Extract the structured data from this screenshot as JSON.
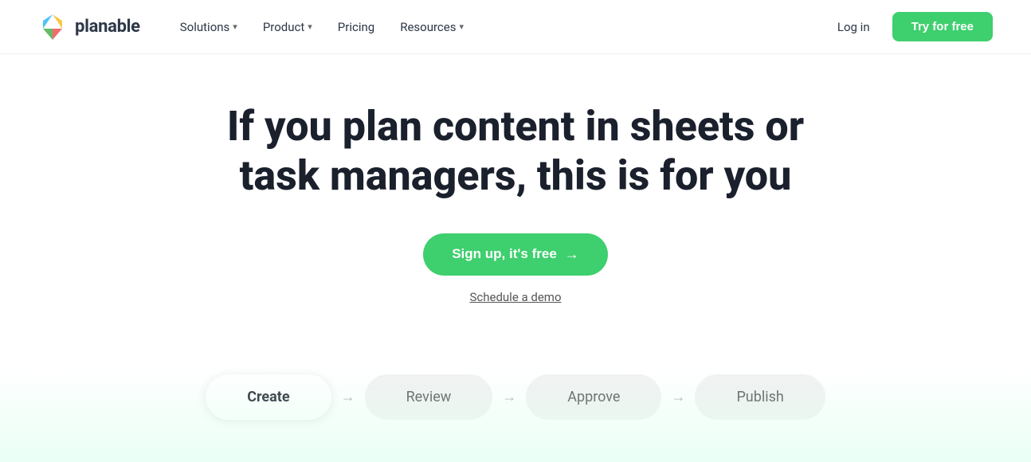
{
  "brand": {
    "name": "planable"
  },
  "nav": {
    "items": [
      {
        "label": "Solutions",
        "has_dropdown": true
      },
      {
        "label": "Product",
        "has_dropdown": true
      },
      {
        "label": "Pricing",
        "has_dropdown": false
      },
      {
        "label": "Resources",
        "has_dropdown": true
      }
    ],
    "login_label": "Log in",
    "try_label": "Try for free"
  },
  "hero": {
    "title": "If you plan content in sheets or task managers, this is for you",
    "signup_label": "Sign up, it's free",
    "signup_arrow": "→",
    "schedule_label": "Schedule a demo"
  },
  "workflow": {
    "steps": [
      {
        "label": "Create",
        "active": true
      },
      {
        "label": "Review",
        "active": false
      },
      {
        "label": "Approve",
        "active": false
      },
      {
        "label": "Publish",
        "active": false
      }
    ],
    "arrow": "→"
  },
  "colors": {
    "green_accent": "#3ecf6e"
  }
}
